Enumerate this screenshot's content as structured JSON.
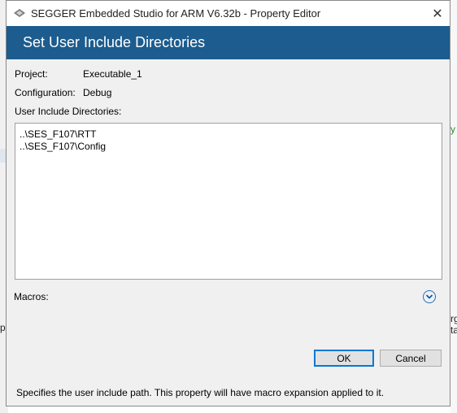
{
  "window": {
    "title": "SEGGER Embedded Studio for ARM V6.32b - Property Editor",
    "close_glyph": "✕"
  },
  "header": {
    "title": "Set User Include Directories"
  },
  "fields": {
    "project_label": "Project:",
    "project_value": "Executable_1",
    "configuration_label": "Configuration:",
    "configuration_value": "Debug",
    "dirs_label": "User Include Directories:"
  },
  "include_dirs": [
    "..\\SES_F107\\RTT",
    "..\\SES_F107\\Config"
  ],
  "macros": {
    "label": "Macros:",
    "expand_icon": "chevron-down-icon"
  },
  "buttons": {
    "ok": "OK",
    "cancel": "Cancel"
  },
  "footer": {
    "help_text": "Specifies the user include path. This property will have macro expansion applied to it."
  },
  "background": {
    "left_fragment": "pa",
    "right_fragment_1": "y",
    "right_fragment_2": "rg",
    "right_fragment_3": "ta"
  },
  "colors": {
    "header_bg": "#1c5c8e",
    "accent": "#0078d7"
  }
}
